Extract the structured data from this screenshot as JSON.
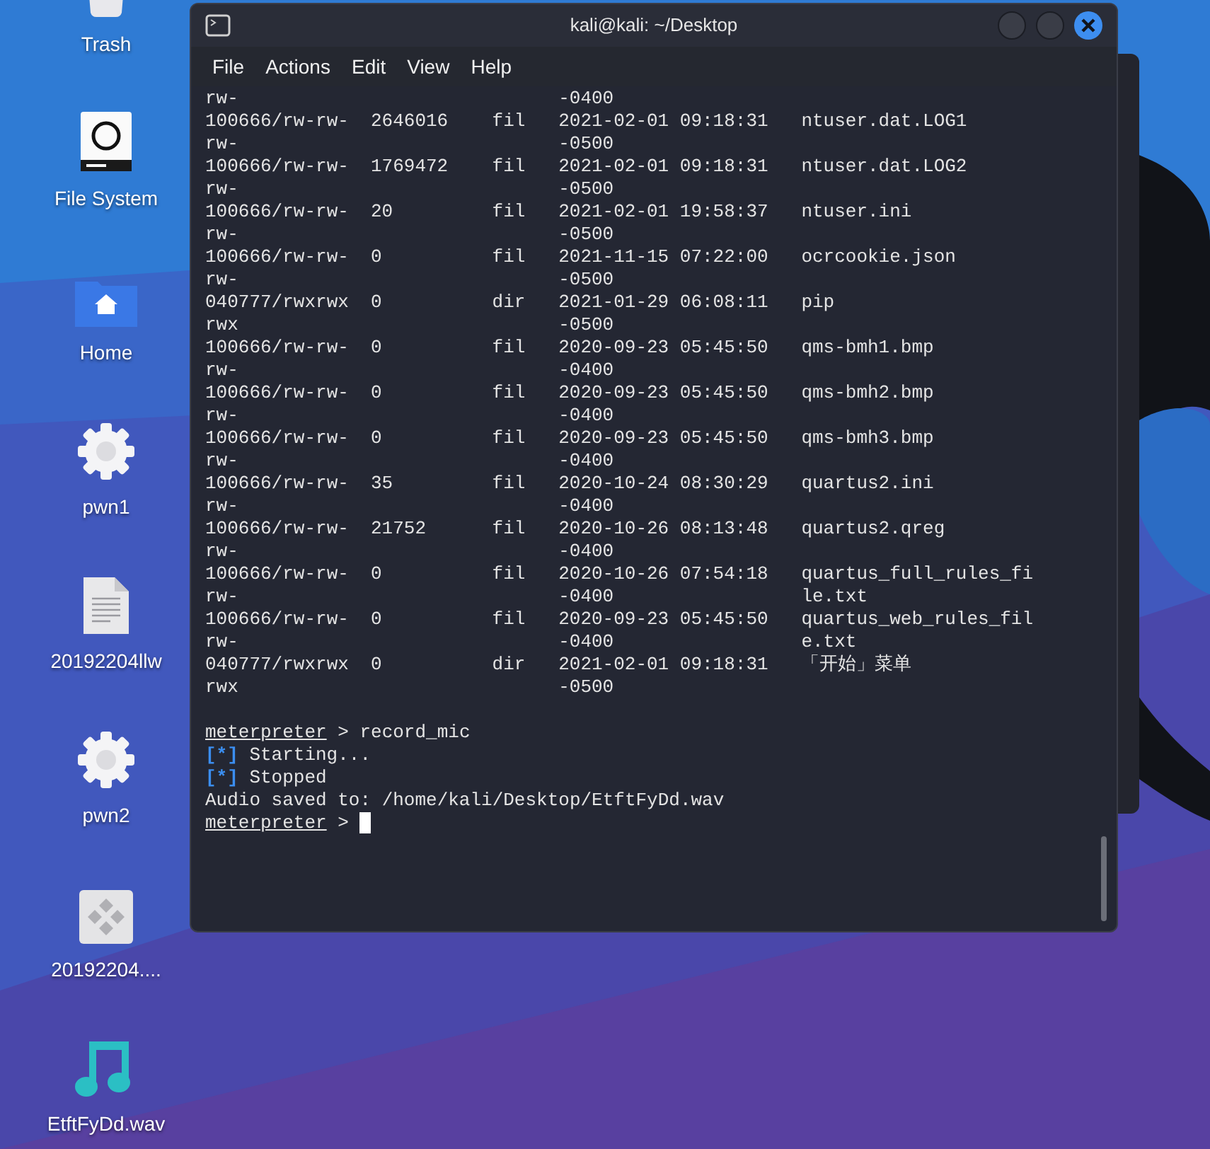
{
  "desktop_icons": [
    {
      "label": "Trash",
      "kind": "trash"
    },
    {
      "label": "File System",
      "kind": "drive"
    },
    {
      "label": "Home",
      "kind": "home"
    },
    {
      "label": "pwn1",
      "kind": "gear"
    },
    {
      "label": "20192204llw",
      "kind": "document"
    },
    {
      "label": "pwn2",
      "kind": "gear"
    },
    {
      "label": "20192204....",
      "kind": "app"
    },
    {
      "label": "EtftFyDd.wav",
      "kind": "music"
    }
  ],
  "terminal": {
    "title": "kali@kali: ~/Desktop",
    "menu": [
      "File",
      "Actions",
      "Edit",
      "View",
      "Help"
    ],
    "listing": [
      {
        "mode": "rw-",
        "modified": "-0400"
      },
      {
        "mode": "100666/rw-rw-rw-",
        "size": "2646016",
        "type": "fil",
        "modified": "2021-02-01 09:18:31 -0500",
        "name": "ntuser.dat.LOG1"
      },
      {
        "mode": "100666/rw-rw-rw-",
        "size": "1769472",
        "type": "fil",
        "modified": "2021-02-01 09:18:31 -0500",
        "name": "ntuser.dat.LOG2"
      },
      {
        "mode": "100666/rw-rw-rw-",
        "size": "20",
        "type": "fil",
        "modified": "2021-02-01 19:58:37 -0500",
        "name": "ntuser.ini"
      },
      {
        "mode": "100666/rw-rw-rw-",
        "size": "0",
        "type": "fil",
        "modified": "2021-11-15 07:22:00 -0500",
        "name": "ocrcookie.json"
      },
      {
        "mode": "040777/rwxrwxrwx",
        "size": "0",
        "type": "dir",
        "modified": "2021-01-29 06:08:11 -0500",
        "name": "pip"
      },
      {
        "mode": "100666/rw-rw-rw-",
        "size": "0",
        "type": "fil",
        "modified": "2020-09-23 05:45:50 -0400",
        "name": "qms-bmh1.bmp"
      },
      {
        "mode": "100666/rw-rw-rw-",
        "size": "0",
        "type": "fil",
        "modified": "2020-09-23 05:45:50 -0400",
        "name": "qms-bmh2.bmp"
      },
      {
        "mode": "100666/rw-rw-rw-",
        "size": "0",
        "type": "fil",
        "modified": "2020-09-23 05:45:50 -0400",
        "name": "qms-bmh3.bmp"
      },
      {
        "mode": "100666/rw-rw-rw-",
        "size": "35",
        "type": "fil",
        "modified": "2020-10-24 08:30:29 -0400",
        "name": "quartus2.ini"
      },
      {
        "mode": "100666/rw-rw-rw-",
        "size": "21752",
        "type": "fil",
        "modified": "2020-10-26 08:13:48 -0400",
        "name": "quartus2.qreg"
      },
      {
        "mode": "100666/rw-rw-rw-",
        "size": "0",
        "type": "fil",
        "modified": "2020-10-26 07:54:18 -0400",
        "name": "quartus_full_rules_file.txt"
      },
      {
        "mode": "100666/rw-rw-rw-",
        "size": "0",
        "type": "fil",
        "modified": "2020-09-23 05:45:50 -0400",
        "name": "quartus_web_rules_file.txt"
      },
      {
        "mode": "040777/rwxrwxrwx",
        "size": "0",
        "type": "dir",
        "modified": "2021-02-01 09:18:31 -0500",
        "name": "「开始」菜单"
      }
    ],
    "output": [
      {
        "kind": "prompt",
        "prompt": "meterpreter",
        "text": "> record_mic",
        "cursor": false
      },
      {
        "kind": "status",
        "marker": "[*]",
        "text": "Starting..."
      },
      {
        "kind": "status",
        "marker": "[*]",
        "text": "Stopped"
      },
      {
        "kind": "plain",
        "text": "Audio saved to: /home/kali/Desktop/EtftFyDd.wav"
      },
      {
        "kind": "prompt",
        "prompt": "meterpreter",
        "text": ">",
        "cursor": true
      }
    ]
  }
}
